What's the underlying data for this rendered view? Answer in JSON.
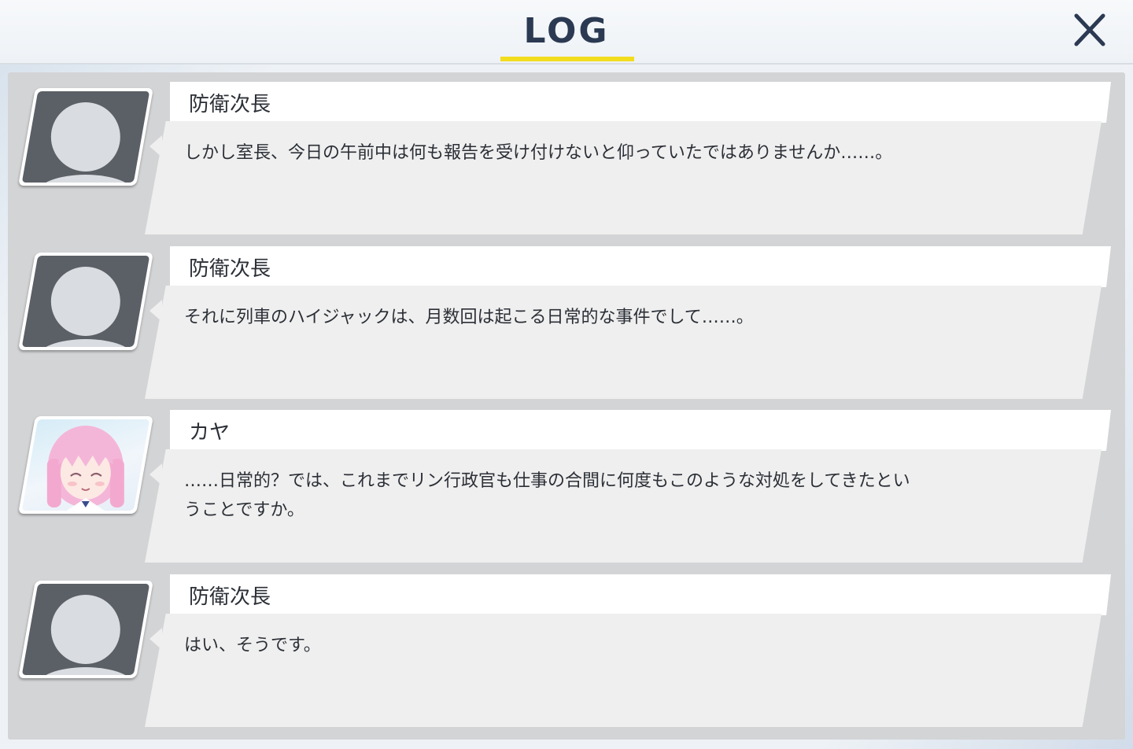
{
  "header": {
    "title": "LOG",
    "close_icon": "close-x-icon",
    "accent_color": "#f2dc1e"
  },
  "entries": [
    {
      "speaker": "防衛次長",
      "avatar": "silhouette-avatar-icon",
      "message": "しかし室長、今日の午前中は何も報告を受け付けないと仰っていたではありませんか……。"
    },
    {
      "speaker": "防衛次長",
      "avatar": "silhouette-avatar-icon",
      "message": "それに列車のハイジャックは、月数回は起こる日常的な事件でして……。"
    },
    {
      "speaker": "カヤ",
      "avatar": "kaya-portrait",
      "message_lines": [
        "……日常的？では、これまでリン行政官も仕事の合間に何度もこのような対処をしてきたとい",
        "うことですか。"
      ]
    },
    {
      "speaker": "防衛次長",
      "avatar": "silhouette-avatar-icon",
      "message": "はい、そうです。"
    }
  ]
}
